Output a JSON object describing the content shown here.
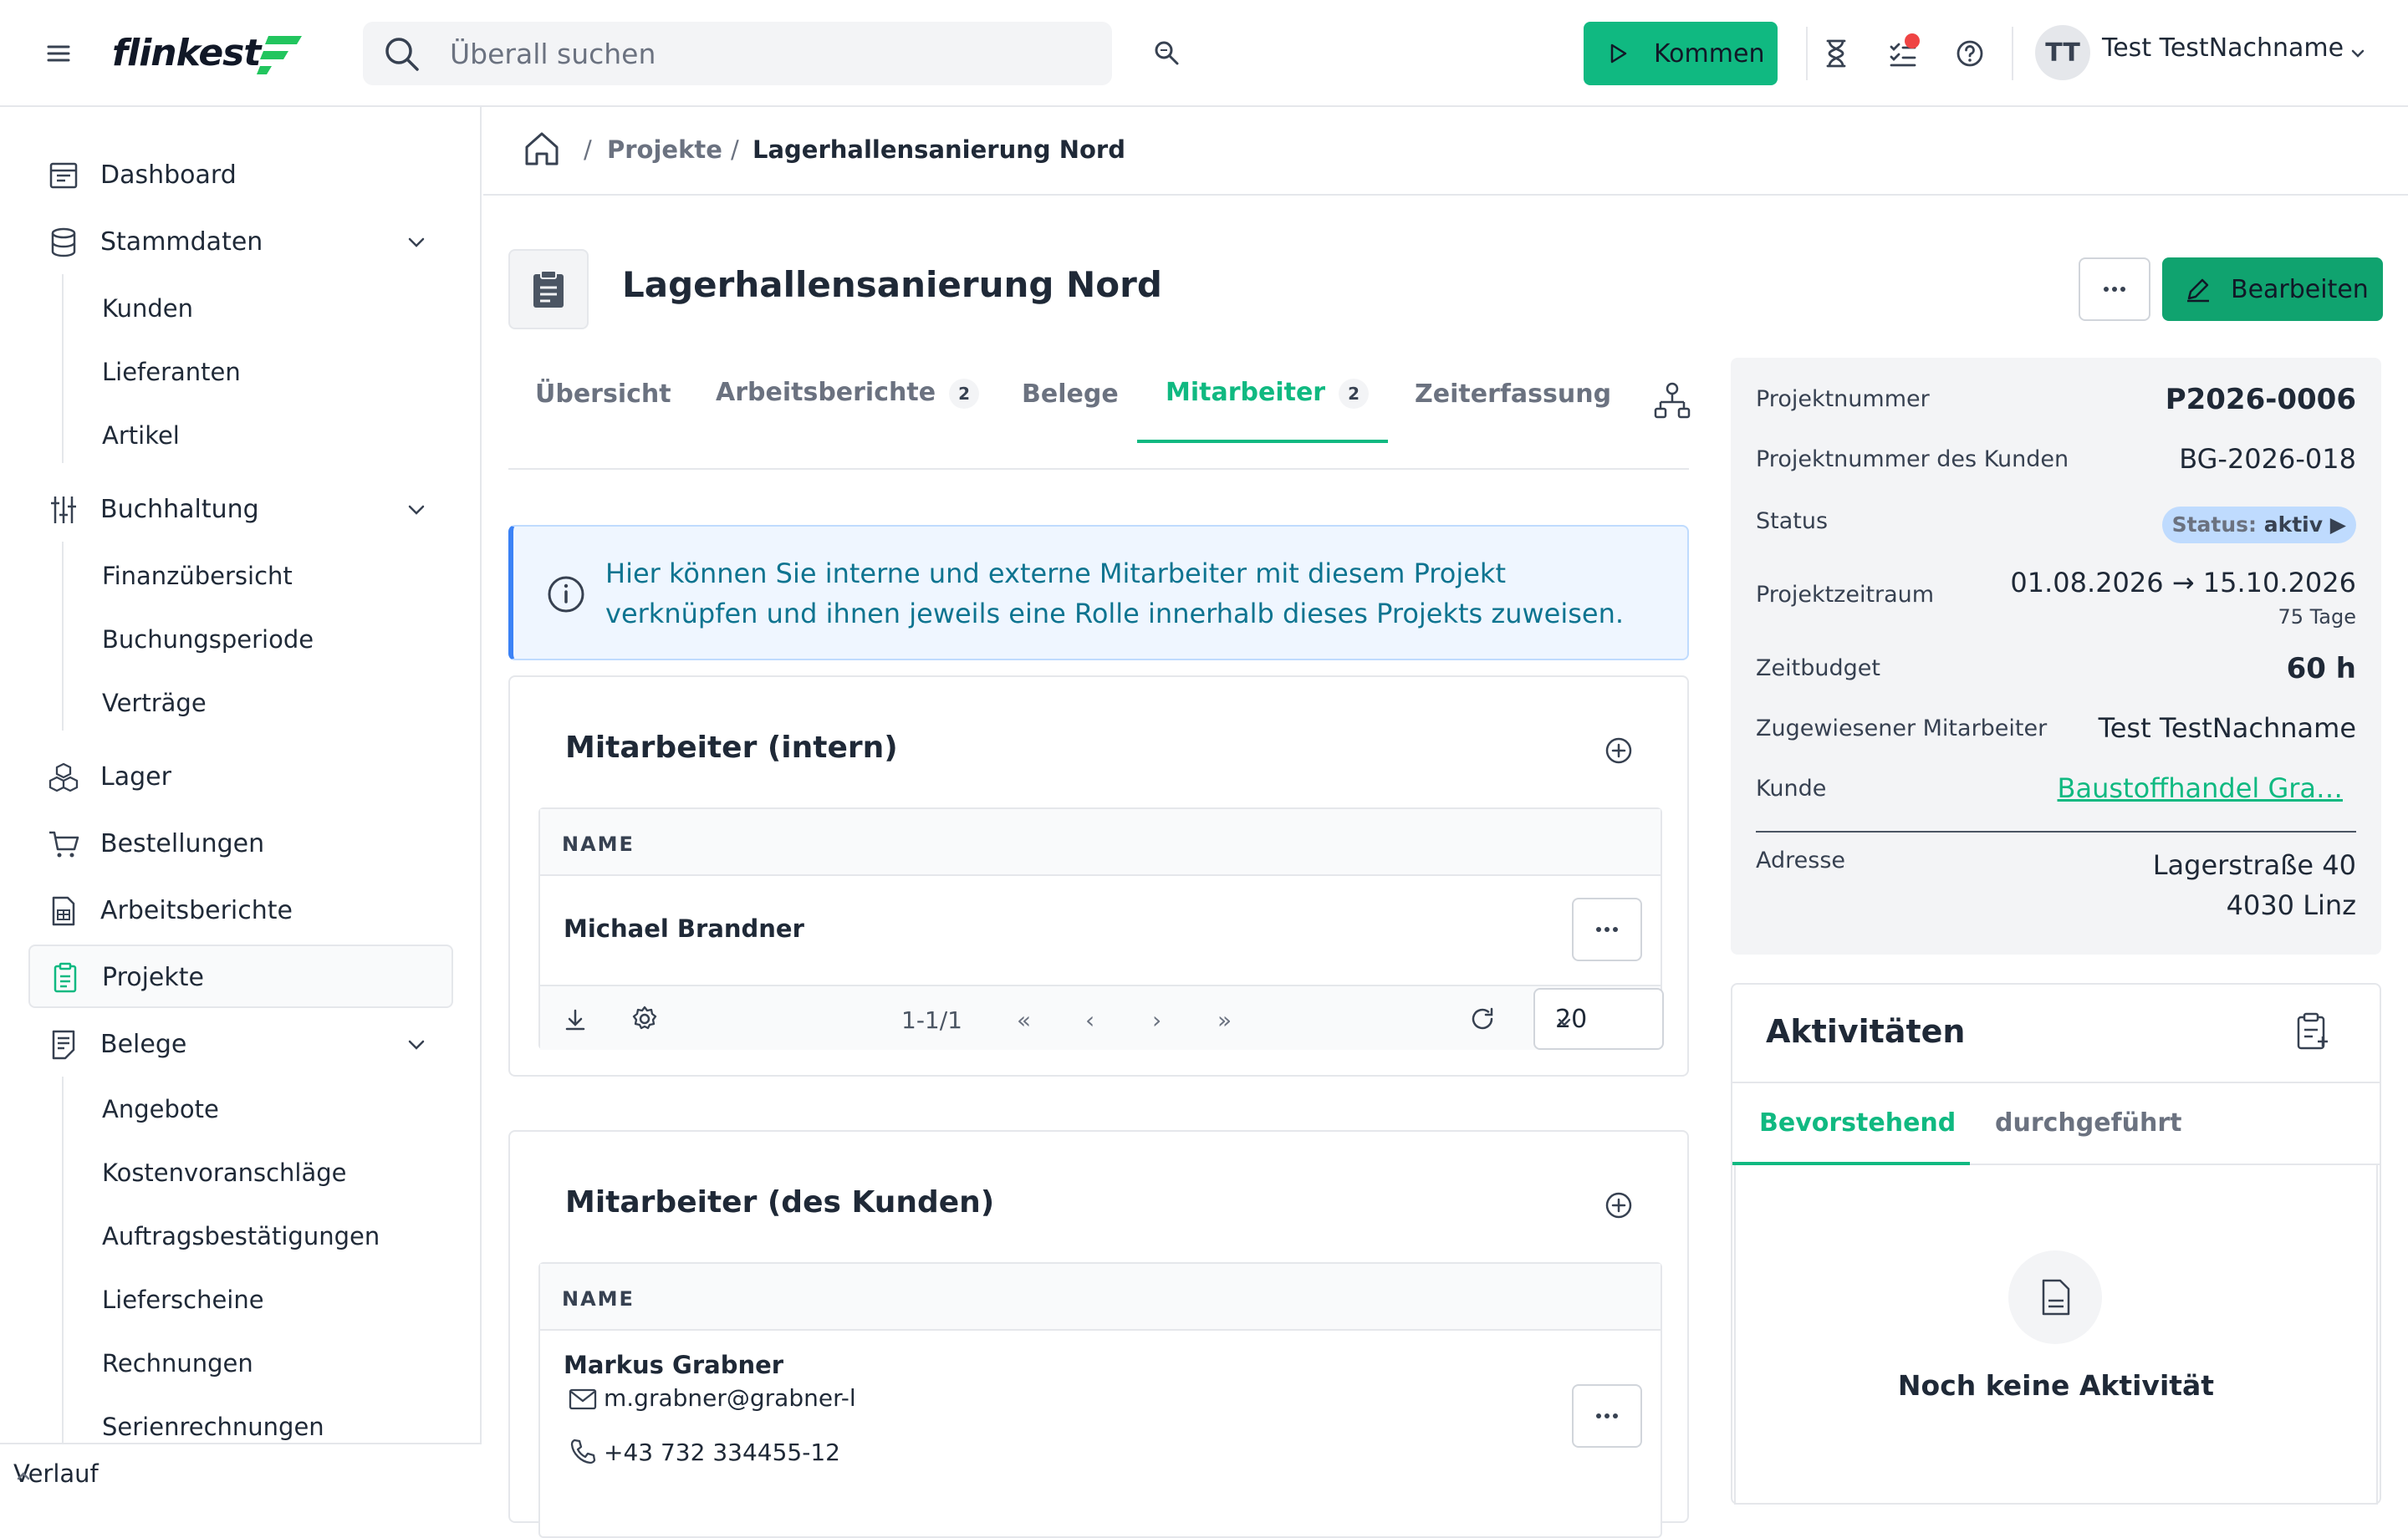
{
  "app": {
    "brand": "flinkest",
    "accent": "#10b981"
  },
  "topbar": {
    "search_placeholder": "Überall suchen",
    "kommen_label": "Kommen",
    "user_initials": "TT",
    "user_name": "Test TestNachname"
  },
  "sidebar": {
    "dashboard": "Dashboard",
    "stammdaten": "Stammdaten",
    "kunden": "Kunden",
    "lieferanten": "Lieferanten",
    "artikel": "Artikel",
    "buchhaltung": "Buchhaltung",
    "finanzuebersicht": "Finanzübersicht",
    "buchungsperiode": "Buchungsperiode",
    "vertraege": "Verträge",
    "lager": "Lager",
    "bestellungen": "Bestellungen",
    "arbeitsberichte": "Arbeitsberichte",
    "projekte": "Projekte",
    "belege": "Belege",
    "angebote": "Angebote",
    "kostenvoranschlaege": "Kostenvoranschläge",
    "auftragsbestaetigungen": "Auftragsbestätigungen",
    "lieferscheine": "Lieferscheine",
    "rechnungen": "Rechnungen",
    "serienrechnungen": "Serienrechnungen",
    "verlauf": "Verlauf"
  },
  "breadcrumb": {
    "sep": "/",
    "parent": "Projekte",
    "current": "Lagerhallensanierung Nord"
  },
  "project": {
    "title": "Lagerhallensanierung Nord",
    "edit_label": "Bearbeiten"
  },
  "tabs": {
    "uebersicht": "Übersicht",
    "arbeitsberichte": "Arbeitsberichte",
    "arbeitsberichte_count": "2",
    "belege": "Belege",
    "mitarbeiter": "Mitarbeiter",
    "mitarbeiter_count": "2",
    "zeiterfassung": "Zeiterfassung"
  },
  "info": {
    "line1": "Hier können Sie interne und externe Mitarbeiter mit diesem Projekt",
    "line2": "verknüpfen und ihnen jeweils eine Rolle innerhalb dieses Projekts zuweisen."
  },
  "intern": {
    "title": "Mitarbeiter (intern)",
    "col_name": "NAME",
    "rows": [
      {
        "name": "Michael Brandner"
      }
    ],
    "pager": {
      "range": "1-1/1",
      "first": "«",
      "prev": "‹",
      "next": "›",
      "last": "»",
      "page_size": "20"
    }
  },
  "kunden_ma": {
    "title": "Mitarbeiter (des Kunden)",
    "col_name": "NAME",
    "rows": [
      {
        "name": "Markus Grabner",
        "email": "m.grabner@grabner-l",
        "phone": "+43 732 334455-12"
      }
    ]
  },
  "details": {
    "projektnummer_label": "Projektnummer",
    "projektnummer": "P2026-0006",
    "kunden_nr_label": "Projektnummer des Kunden",
    "kunden_nr": "BG-2026-018",
    "status_label": "Status",
    "status_prefix": "Status:",
    "status_value": "aktiv",
    "status_arrow": "▶",
    "zeitraum_label": "Projektzeitraum",
    "zeitraum": "01.08.2026 → 15.10.2026",
    "zeitraum_days": "75 Tage",
    "budget_label": "Zeitbudget",
    "budget": "60 h",
    "mitarbeiter_label": "Zugewiesener Mitarbeiter",
    "mitarbeiter": "Test TestNachname",
    "kunde_label": "Kunde",
    "kunde": "Baustoffhandel Gra…",
    "adresse_label": "Adresse",
    "adresse1": "Lagerstraße 40",
    "adresse2": "4030 Linz"
  },
  "activities": {
    "title": "Aktivitäten",
    "tab_upcoming": "Bevorstehend",
    "tab_done": "durchgeführt",
    "empty": "Noch keine Aktivität"
  }
}
